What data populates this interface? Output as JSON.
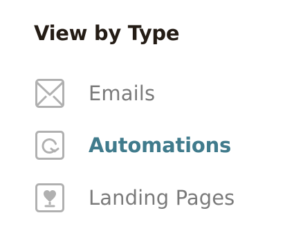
{
  "panel": {
    "heading": "View by Type",
    "items": [
      {
        "label": "Emails",
        "icon": "envelope-icon",
        "active": false
      },
      {
        "label": "Automations",
        "icon": "automation-icon",
        "active": true
      },
      {
        "label": "Landing Pages",
        "icon": "landing-page-icon",
        "active": false
      }
    ]
  },
  "colors": {
    "heading": "#241c15",
    "inactive_label": "#7a7a7a",
    "active_label": "#407b8c",
    "icon_stroke": "#b0b0b0"
  }
}
